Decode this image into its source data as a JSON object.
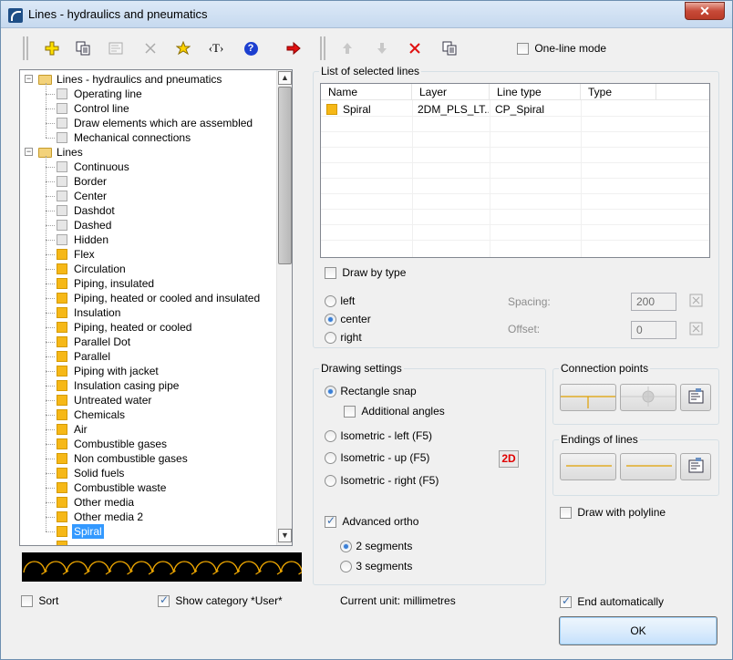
{
  "window": {
    "title": "Lines - hydraulics and pneumatics",
    "close_glyph": "✕"
  },
  "toolbar": {
    "one_line_mode_label": "One-line mode",
    "one_line_mode_checked": false,
    "text_button_label": "‹T›",
    "help_button_label": "?"
  },
  "tree": {
    "groups": [
      {
        "label": "Lines - hydraulics and pneumatics",
        "items": [
          {
            "label": "Operating line",
            "color": "grey"
          },
          {
            "label": "Control line",
            "color": "grey"
          },
          {
            "label": "Draw elements which are assembled",
            "color": "grey"
          },
          {
            "label": "Mechanical connections",
            "color": "grey"
          }
        ]
      },
      {
        "label": "Lines",
        "items": [
          {
            "label": "Continuous",
            "color": "grey"
          },
          {
            "label": "Border",
            "color": "grey"
          },
          {
            "label": "Center",
            "color": "grey"
          },
          {
            "label": "Dashdot",
            "color": "grey"
          },
          {
            "label": "Dashed",
            "color": "grey"
          },
          {
            "label": "Hidden",
            "color": "grey"
          },
          {
            "label": "Flex",
            "color": "yellow"
          },
          {
            "label": "Circulation",
            "color": "yellow"
          },
          {
            "label": "Piping, insulated",
            "color": "yellow"
          },
          {
            "label": "Piping, heated or cooled and insulated",
            "color": "yellow"
          },
          {
            "label": "Insulation",
            "color": "yellow"
          },
          {
            "label": "Piping, heated or cooled",
            "color": "yellow"
          },
          {
            "label": "Parallel Dot",
            "color": "yellow"
          },
          {
            "label": "Parallel",
            "color": "yellow"
          },
          {
            "label": "Piping with jacket",
            "color": "yellow"
          },
          {
            "label": "Insulation casing pipe",
            "color": "yellow"
          },
          {
            "label": "Untreated water",
            "color": "yellow"
          },
          {
            "label": "Chemicals",
            "color": "yellow"
          },
          {
            "label": "Air",
            "color": "yellow"
          },
          {
            "label": "Combustible gases",
            "color": "yellow"
          },
          {
            "label": "Non combustible gases",
            "color": "yellow"
          },
          {
            "label": "Solid fuels",
            "color": "yellow"
          },
          {
            "label": "Combustible waste",
            "color": "yellow"
          },
          {
            "label": "Other media",
            "color": "yellow"
          },
          {
            "label": "Other media 2",
            "color": "yellow"
          },
          {
            "label": "Spiral",
            "color": "yellow",
            "selected": true
          }
        ]
      }
    ],
    "expander_glyph": "−"
  },
  "selected_lines": {
    "group_title": "List of selected lines",
    "columns": [
      "Name",
      "Layer",
      "Line type",
      "Type"
    ],
    "rows": [
      {
        "name": "Spiral",
        "layer": "2DM_PLS_LT...",
        "line_type": "CP_Spiral",
        "type": ""
      }
    ],
    "draw_by_type_label": "Draw by type",
    "draw_by_type_checked": false,
    "alignment": {
      "options": [
        "left",
        "center",
        "right"
      ],
      "selected": "center"
    },
    "spacing_label": "Spacing:",
    "spacing_value": "200",
    "offset_label": "Offset:",
    "offset_value": "0"
  },
  "drawing_settings": {
    "title": "Drawing settings",
    "rectangle_snap_label": "Rectangle snap",
    "additional_angles_label": "Additional angles",
    "additional_angles_checked": false,
    "isometric_left_label": "Isometric - left (F5)",
    "isometric_up_label": "Isometric - up (F5)",
    "isometric_right_label": "Isometric - right (F5)",
    "selected_mode": "Rectangle snap",
    "badge_2d": "2D",
    "advanced_ortho_label": "Advanced ortho",
    "advanced_ortho_checked": true,
    "segments_2_label": "2 segments",
    "segments_3_label": "3 segments",
    "selected_segments": "2 segments"
  },
  "connection_points": {
    "title": "Connection points"
  },
  "endings_of_lines": {
    "title": "Endings of lines"
  },
  "draw_with_polyline_label": "Draw with polyline",
  "draw_with_polyline_checked": false,
  "footer": {
    "sort_label": "Sort",
    "sort_checked": false,
    "show_category_label": "Show category *User*",
    "show_category_checked": true,
    "current_unit": "Current unit: millimetres",
    "end_automatically_label": "End automatically",
    "end_automatically_checked": true,
    "ok_label": "OK"
  },
  "colors": {
    "swatch_yellow": "#f6b817",
    "preview_line": "#f0a800",
    "selection_blue": "#3399ff",
    "line_ending_color": "#e0a000"
  }
}
